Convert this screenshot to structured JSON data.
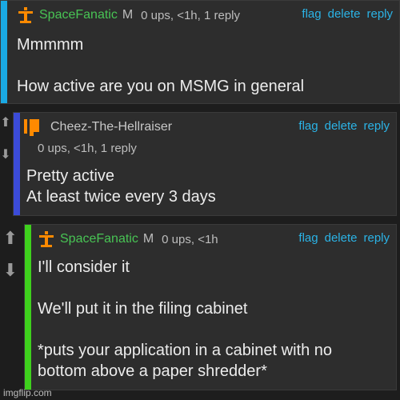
{
  "colors": {
    "page_bg": "#1d1d1d",
    "card_bg": "#2d2d2d",
    "action_blue": "#2bb3e6",
    "user_green": "#48c454",
    "accent_cyan": "#1aa9e3",
    "accent_blue": "#3b4bd8",
    "accent_green": "#3ed11d",
    "icon_orange": "#ff8a00"
  },
  "actions": {
    "flag": "flag",
    "delete": "delete",
    "reply": "reply"
  },
  "comments": [
    {
      "username": "SpaceFanatic",
      "badge": "M",
      "meta": "0 ups, <1h, 1 reply",
      "icon": "rocket-icon",
      "lines": [
        "Mmmmm",
        "",
        "How active are you on MSMG in general"
      ]
    },
    {
      "username": "Cheez-The-Hellraiser",
      "meta": "0 ups, <1h, 1 reply",
      "icon": "flame-icon",
      "lines": [
        "Pretty active",
        "At least twice every 3 days"
      ]
    },
    {
      "username": "SpaceFanatic",
      "badge": "M",
      "meta": "0 ups, <1h",
      "icon": "rocket-icon",
      "lines": [
        "I'll consider it",
        "",
        "We'll put it in the filing cabinet",
        "",
        "*puts your application in a cabinet with no",
        "bottom above a paper shredder*"
      ]
    }
  ],
  "watermark": "imgflip.com"
}
